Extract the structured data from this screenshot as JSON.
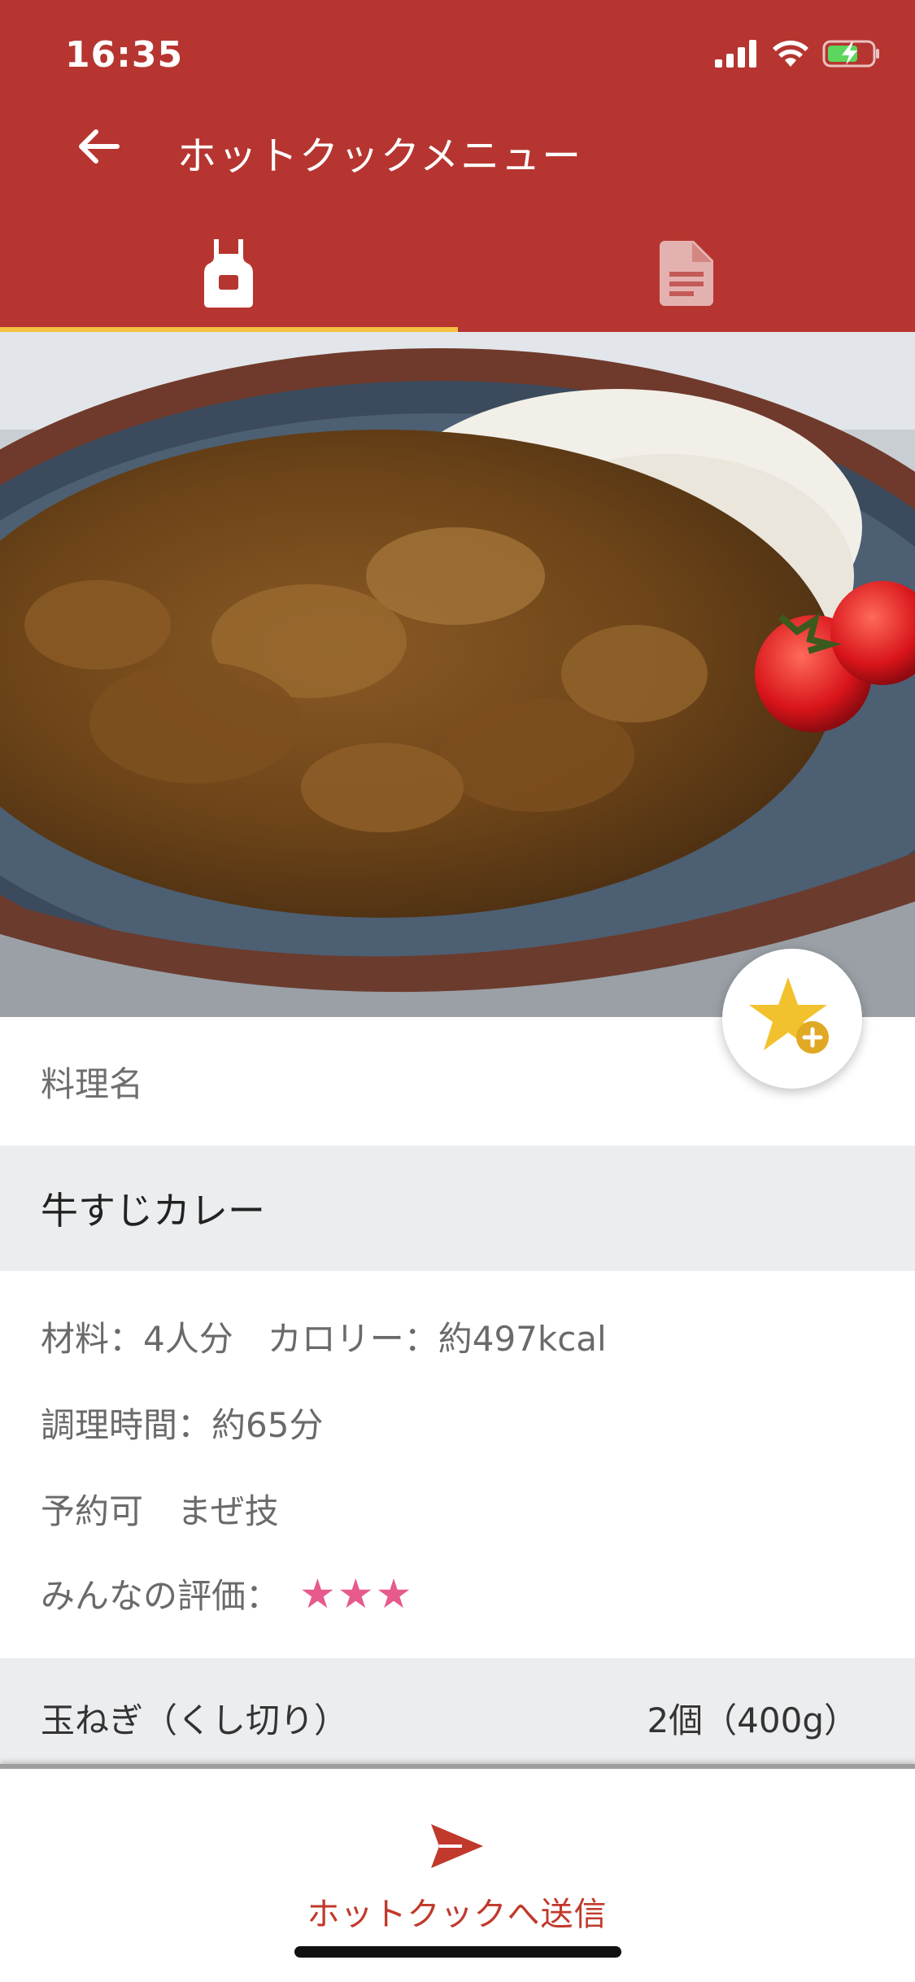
{
  "status_bar": {
    "time": "16:35"
  },
  "appbar": {
    "title": "ホットクックメニュー"
  },
  "tabs": [
    {
      "icon": "apron-icon",
      "active": true
    },
    {
      "icon": "document-icon",
      "active": false
    }
  ],
  "recipe": {
    "name_label": "料理名",
    "name": "牛すじカレー",
    "servings_calories": "材料：4人分　カロリー：約497kcal",
    "cook_time": "調理時間：約65分",
    "tags": "予約可　まぜ技",
    "rating_label": "みんなの評価：",
    "rating_stars": "★★★",
    "rating_value": 3
  },
  "ingredients": [
    {
      "name": "玉ねぎ（くし切り）",
      "amount": "2個（400g）"
    }
  ],
  "bottom_bar": {
    "send_label": "ホットクックへ送信"
  },
  "colors": {
    "primary": "#B63530",
    "tab_indicator": "#F5C142",
    "star_rating": "#E65A8E",
    "favorite_star": "#F2C12E",
    "send": "#C0392B"
  }
}
